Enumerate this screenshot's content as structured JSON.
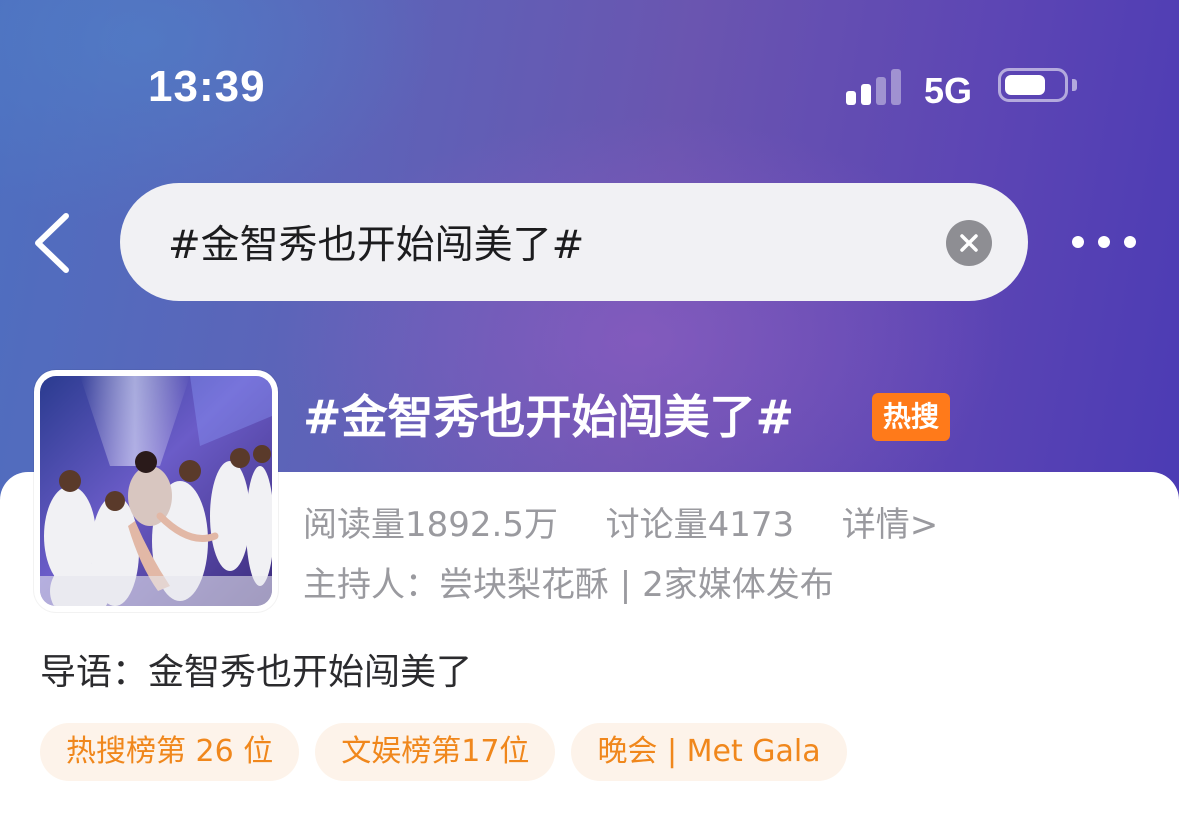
{
  "status_bar": {
    "time": "13:39",
    "network": "5G",
    "signal_bars_active": 2,
    "signal_bars_total": 4
  },
  "search": {
    "query": "#金智秀也开始闯美了#"
  },
  "topic": {
    "title": "#金智秀也开始闯美了#",
    "hot_badge": "热搜",
    "reads": "阅读量1892.5万",
    "discussions": "讨论量4173",
    "details_link": "详情>",
    "host_line": "主持人：尝块梨花酥 | 2家媒体发布",
    "intro": "导语：金智秀也开始闯美了"
  },
  "tags": [
    {
      "label": "热搜榜第 26 位"
    },
    {
      "label": "文娱榜第17位"
    },
    {
      "label": "晚会 | Met Gala"
    }
  ],
  "colors": {
    "accent_orange": "#f0871c",
    "hot_badge_bg": "#ff7a1a",
    "tag_bg": "#fdf3ea",
    "header_gradient_start": "#4e6fc0",
    "header_gradient_end": "#4b3bb4"
  },
  "icons": {
    "back": "chevron-left-icon",
    "clear": "clear-x-icon",
    "more": "more-dots-icon"
  }
}
